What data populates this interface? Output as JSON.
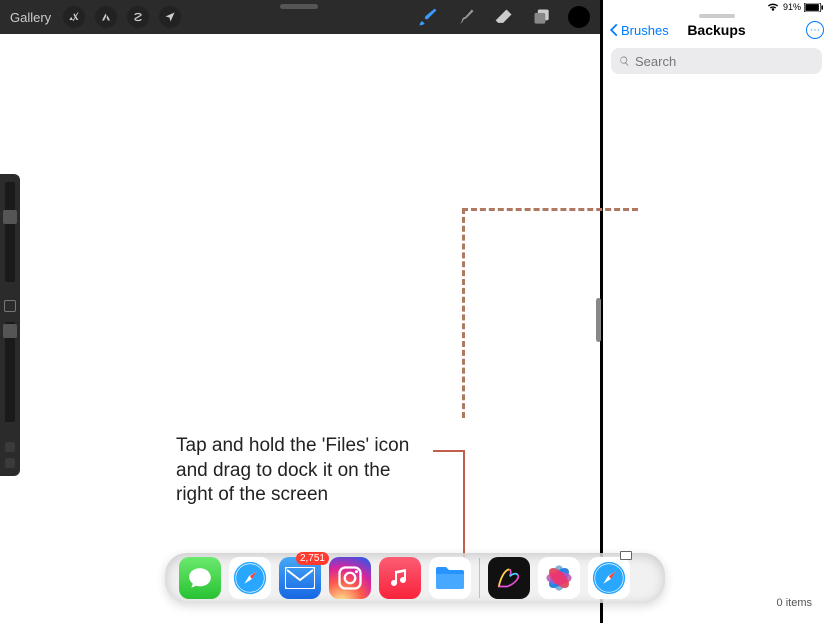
{
  "toolbar": {
    "gallery_label": "Gallery"
  },
  "status": {
    "battery_pct": "91%"
  },
  "panel": {
    "back_label": "Brushes",
    "title": "Backups",
    "search_placeholder": "Search",
    "items_count": "0 items"
  },
  "annotation": {
    "text": "Tap and hold the 'Files' icon and drag to dock it on the right of the screen"
  },
  "dock": {
    "mail_badge": "2,751"
  }
}
